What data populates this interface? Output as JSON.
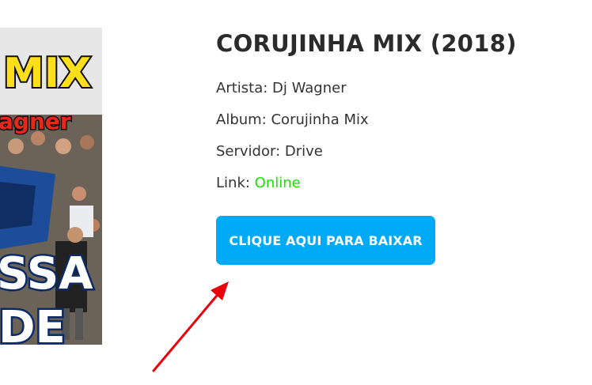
{
  "album": {
    "title": "CORUJINHA MIX (2018)",
    "artist_label": "Artista:",
    "artist": "Dj Wagner",
    "album_label": "Album:",
    "album_name": "Corujinha Mix",
    "server_label": "Servidor:",
    "server": "Drive",
    "link_label": "Link:",
    "link_status": "Online"
  },
  "cover": {
    "text_top": "MIX",
    "text_name": "agner",
    "text_mid": "SSA",
    "text_bottom": "DE"
  },
  "download_button": {
    "label": "CLIQUE AQUI PARA BAIXAR"
  },
  "colors": {
    "button": "#00aaf4",
    "status_online": "#18e200",
    "arrow": "#e8000b"
  }
}
